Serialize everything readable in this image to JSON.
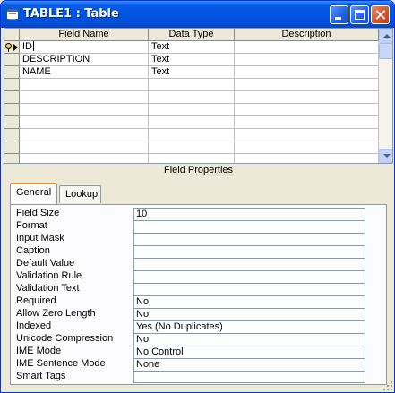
{
  "window": {
    "title": "TABLE1 : Table",
    "icon": "table-icon",
    "buttons": [
      "minimize-icon",
      "maximize-icon",
      "close-icon"
    ]
  },
  "grid": {
    "columns": [
      "Field Name",
      "Data Type",
      "Description"
    ],
    "rows": [
      {
        "field_name": "ID",
        "data_type": "Text",
        "description": "",
        "primary_key": true,
        "current": true
      },
      {
        "field_name": "DESCRIPTION",
        "data_type": "Text",
        "description": ""
      },
      {
        "field_name": "NAME",
        "data_type": "Text",
        "description": ""
      }
    ],
    "empty_rows": 7
  },
  "field_properties": {
    "title": "Field Properties",
    "tabs": [
      {
        "label": "General",
        "active": true
      },
      {
        "label": "Lookup",
        "active": false
      }
    ],
    "properties": [
      {
        "label": "Field Size",
        "value": "10"
      },
      {
        "label": "Format",
        "value": ""
      },
      {
        "label": "Input Mask",
        "value": ""
      },
      {
        "label": "Caption",
        "value": ""
      },
      {
        "label": "Default Value",
        "value": ""
      },
      {
        "label": "Validation Rule",
        "value": ""
      },
      {
        "label": "Validation Text",
        "value": ""
      },
      {
        "label": "Required",
        "value": "No"
      },
      {
        "label": "Allow Zero Length",
        "value": "No"
      },
      {
        "label": "Indexed",
        "value": "Yes (No Duplicates)"
      },
      {
        "label": "Unicode Compression",
        "value": "No"
      },
      {
        "label": "IME Mode",
        "value": "No Control"
      },
      {
        "label": "IME Sentence Mode",
        "value": "None"
      },
      {
        "label": "Smart Tags",
        "value": ""
      }
    ]
  },
  "colors": {
    "title_bar": "#0054e3",
    "window_bg": "#ece9d8",
    "active_tab_accent": "#e68b2c"
  }
}
